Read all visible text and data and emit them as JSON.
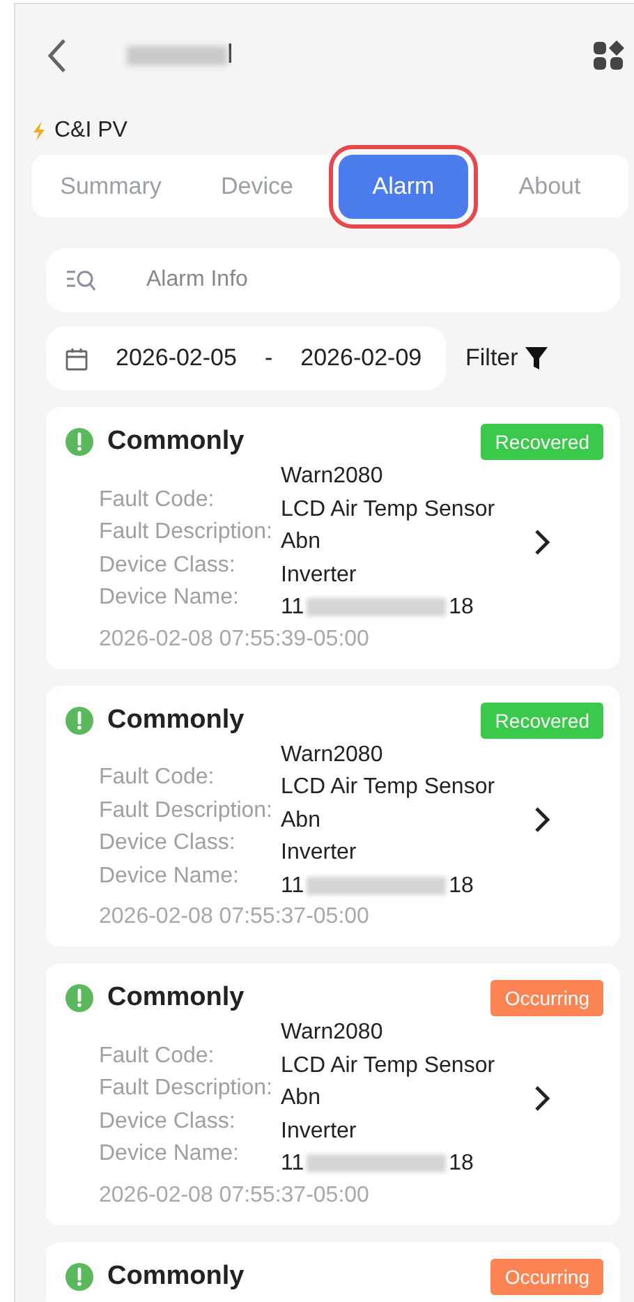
{
  "header": {
    "title_visible": "l"
  },
  "plant_type": "C&I PV",
  "tabs": [
    {
      "label": "Summary",
      "selected": false
    },
    {
      "label": "Device",
      "selected": false
    },
    {
      "label": "Alarm",
      "selected": true
    },
    {
      "label": "About",
      "selected": false
    }
  ],
  "search": {
    "placeholder": "Alarm Info"
  },
  "date_range": {
    "start": "2026-02-05",
    "separator": "-",
    "end": "2026-02-09"
  },
  "filter": {
    "label": "Filter"
  },
  "alarms": [
    {
      "level": "Commonly",
      "status": "Recovered",
      "kind": "recovered",
      "field_labels": [
        "Fault Code:",
        "Fault Description:",
        "Device Class:",
        "Device Name:"
      ],
      "fault_code": "Warn2080",
      "fault_description": "LCD Air Temp Sensor Abn",
      "device_class": "Inverter",
      "device_name_start": "11",
      "device_name_end": "18",
      "time": "2026-02-08 07:55:39-05:00"
    },
    {
      "level": "Commonly",
      "status": "Recovered",
      "kind": "recovered",
      "field_labels": [
        "Fault Code:",
        "Fault Description:",
        "Device Class:",
        "Device Name:"
      ],
      "fault_code": "Warn2080",
      "fault_description": "LCD Air Temp Sensor Abn",
      "device_class": "Inverter",
      "device_name_start": "11",
      "device_name_end": "18",
      "time": "2026-02-08 07:55:37-05:00"
    },
    {
      "level": "Commonly",
      "status": "Occurring",
      "kind": "occurring",
      "field_labels": [
        "Fault Code:",
        "Fault Description:",
        "Device Class:",
        "Device Name:"
      ],
      "fault_code": "Warn2080",
      "fault_description": "LCD Air Temp Sensor Abn",
      "device_class": "Inverter",
      "device_name_start": "11",
      "device_name_end": "18",
      "time": "2026-02-08 07:55:37-05:00"
    },
    {
      "level": "Commonly",
      "status": "Occurring",
      "kind": "occurring"
    }
  ]
}
